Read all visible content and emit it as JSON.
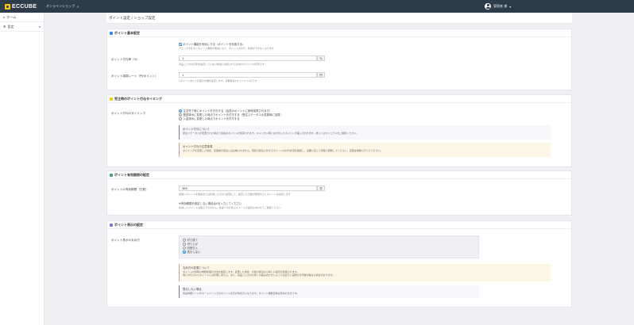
{
  "topbar": {
    "logo_text": "ECCUBE",
    "shop_link": "オンラインショップ",
    "shop_link_icon": "external-link-icon",
    "user_name": "管理者 様",
    "user_icon": "user-circle-icon",
    "bg_color": "#2d3c48"
  },
  "sidebar": {
    "items": [
      {
        "icon": "home-icon",
        "label": "ホーム"
      },
      {
        "icon": "settings-icon",
        "label": "設定",
        "caret": "▼"
      }
    ]
  },
  "page": {
    "title": "ポイント設定 / ショップ設定"
  },
  "point_card": {
    "title": "ポイント基本設定",
    "icon_color": "#2f8ce0",
    "enable_label": "ポイント機能を有効にする（ポイントを利用する）",
    "enable_help": "チェックを外すとポイント機能が無効になり、ポイントの付与・利用ができなくなります",
    "rate_label": "ポイント付与率（%）",
    "rate_value": "1",
    "rate_unit": "%",
    "rate_help": "商品ごとの付与率を設定していない場合に適用される基本のポイント付与率です",
    "conv_label": "ポイント換算レート（円/ポイント）",
    "conv_value": "1",
    "conv_unit": "円",
    "conv_help": "1ポイントあたりの値引き額を設定します。初期値は1ポイント＝1円です"
  },
  "order_card": {
    "title": "受注時のポイント付与タイミング",
    "icon_color": "#f5c518",
    "label": "ポイント付与のタイミング",
    "options": [
      "注文完了時にポイントを付与する（会員のポイントに即時加算されます）",
      "発送済みに変更した時点でポイントを付与する（受注ステータスの変更時に加算）",
      "入金済みに変更した時点でポイントを付与する"
    ],
    "note_info_title": "ポイント付与について",
    "note_info_text": "受注ステータスが変更された時点で会員のポイントが加算されます。キャンセル時には付与したポイントが差し引かれます。詳しくはマニュアルをご確認ください。",
    "note_warn_title": "ポイント付与の注意事項",
    "note_warn_text": "タイミングを変更した場合、変更前の受注には反映されません。既存の受注に対するポイントの付与状況を確認し、必要に応じて手動で調整してください。変更は慎重に行ってください。"
  },
  "expire_card": {
    "title": "ポイント有効期限の設定",
    "icon_color": "#3fa86a",
    "label": "ポイントの有効期限（日数）",
    "value": "365",
    "unit": "日",
    "help": "最後にポイントを獲得または利用した日から起算して、設定した日数が経過するとポイントは失効します",
    "sub_title": "※有効期限を設定しない場合は0を入力してください",
    "sub_help": "失効したポイントは復元できません。会員へのお知らせメールの設定もあわせてご確認ください"
  },
  "display_card": {
    "title": "ポイント表示の設定",
    "icon_color": "#8a6fd1",
    "label": "ポイント表示の丸め方",
    "options": [
      "切り捨て",
      "切り上げ",
      "四捨五入",
      "表示しない"
    ],
    "selected_index": 3,
    "note_warn_title": "丸め方の変更について",
    "note_warn_lines": [
      "ポイント計算時の端数処理の方法を設定します。変更した場合、今後の受注から新しい設定が適用されます。",
      "既に付与されたポイントには影響しません。また、商品ごとの付与率との組み合わせによっては表示と実際の付与数が異なる場合があります。"
    ],
    "note_info_title": "表示しない場合",
    "note_info_text": "商品詳細ページやカートページでのポイント表示が非表示になります。ポイント機能自体は有効のままです。"
  }
}
